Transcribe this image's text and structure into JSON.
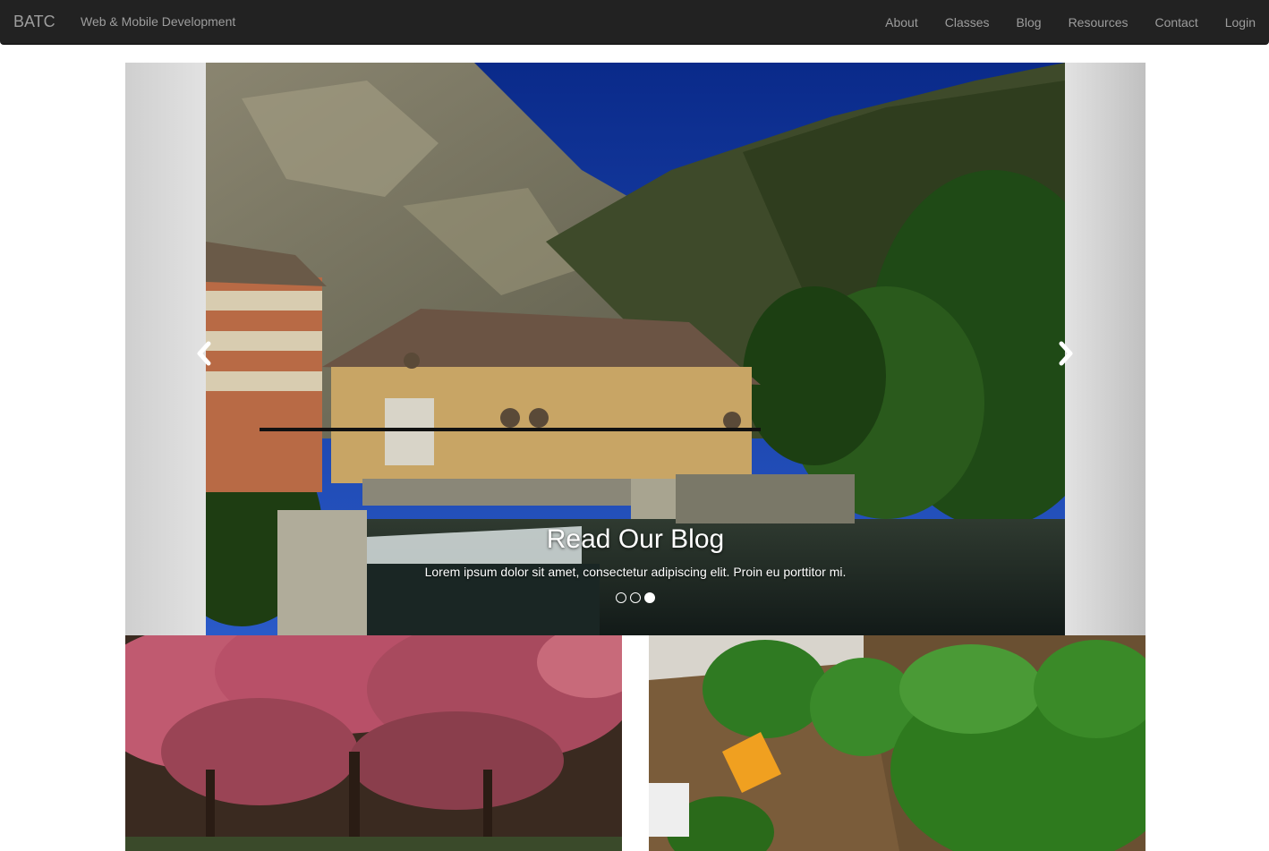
{
  "navbar": {
    "brand": "BATC",
    "tagline": "Web & Mobile Development",
    "links": [
      "About",
      "Classes",
      "Blog",
      "Resources",
      "Contact",
      "Login"
    ]
  },
  "carousel": {
    "title": "Read Our Blog",
    "text": "Lorem ipsum dolor sit amet, consectetur adipiscing elit. Proin eu porttitor mi.",
    "slide_count": 3,
    "active_slide": 3,
    "prev_icon": "chevron-left-icon",
    "next_icon": "chevron-right-icon"
  },
  "colors": {
    "navbar_bg": "#222222",
    "navbar_text": "#9d9d9d",
    "carousel_bg": "#d3d3d3"
  }
}
